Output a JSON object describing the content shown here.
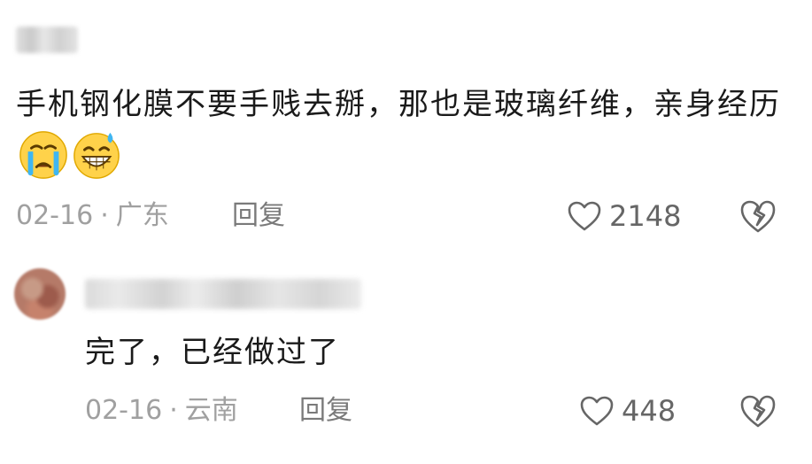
{
  "comments": [
    {
      "text": "手机钢化膜不要手贱去掰，那也是玻璃纤维，亲身经历",
      "emojis": [
        "crying-face-icon",
        "grinning-sweat-face-icon"
      ],
      "date": "02-16",
      "separator": "·",
      "location": "广东",
      "reply_label": "回复",
      "likes": "2148"
    },
    {
      "text": "完了，已经做过了",
      "date": "02-16",
      "separator": "·",
      "location": "云南",
      "reply_label": "回复",
      "likes": "448"
    }
  ],
  "colors": {
    "text": "#1a1a1a",
    "meta": "#a0a0a0",
    "reply": "#7a7a7a",
    "icon": "#666666"
  }
}
